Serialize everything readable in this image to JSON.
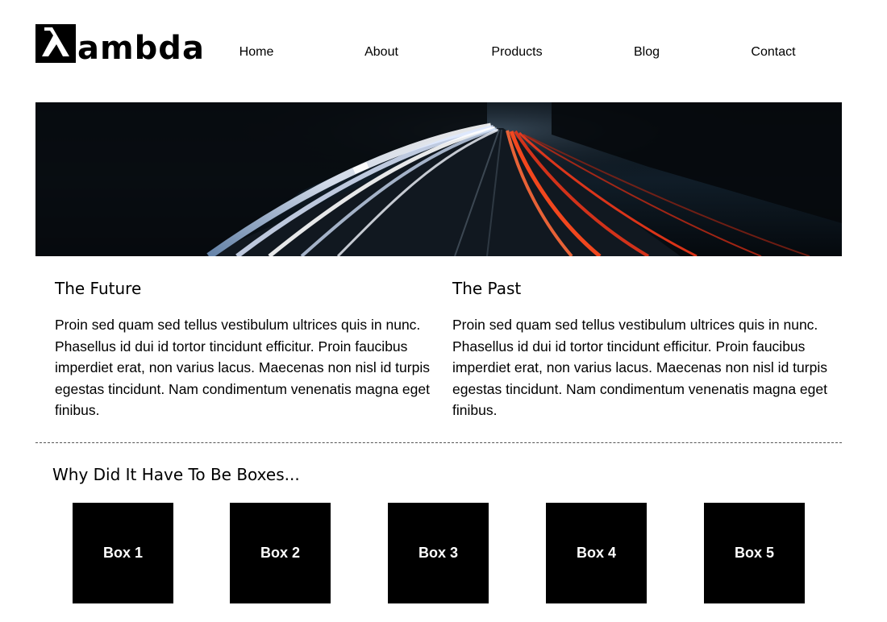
{
  "logo": {
    "text": "ambda",
    "mark": "lambda-icon"
  },
  "nav": {
    "items": [
      {
        "label": "Home"
      },
      {
        "label": "About"
      },
      {
        "label": "Products"
      },
      {
        "label": "Blog"
      },
      {
        "label": "Contact"
      }
    ]
  },
  "hero": {
    "image": "highway-light-trails-at-night"
  },
  "columns": [
    {
      "title": "The Future",
      "body": "Proin sed quam sed tellus vestibulum ultrices quis in nunc. Phasellus id dui id tortor tincidunt efficitur. Proin faucibus imperdiet erat, non varius lacus. Maecenas non nisl id turpis egestas tincidunt. Nam condimentum venenatis magna eget finibus."
    },
    {
      "title": "The Past",
      "body": "Proin sed quam sed tellus vestibulum ultrices quis in nunc. Phasellus id dui id tortor tincidunt efficitur. Proin faucibus imperdiet erat, non varius lacus. Maecenas non nisl id turpis egestas tincidunt. Nam condimentum venenatis magna eget finibus."
    }
  ],
  "boxes_section": {
    "title": "Why Did It Have To Be Boxes...",
    "boxes": [
      {
        "label": "Box 1"
      },
      {
        "label": "Box 2"
      },
      {
        "label": "Box 3"
      },
      {
        "label": "Box 4"
      },
      {
        "label": "Box 5"
      }
    ]
  },
  "colors": {
    "background": "#ffffff",
    "text": "#000000",
    "box": "#000000",
    "box_text": "#ffffff"
  }
}
